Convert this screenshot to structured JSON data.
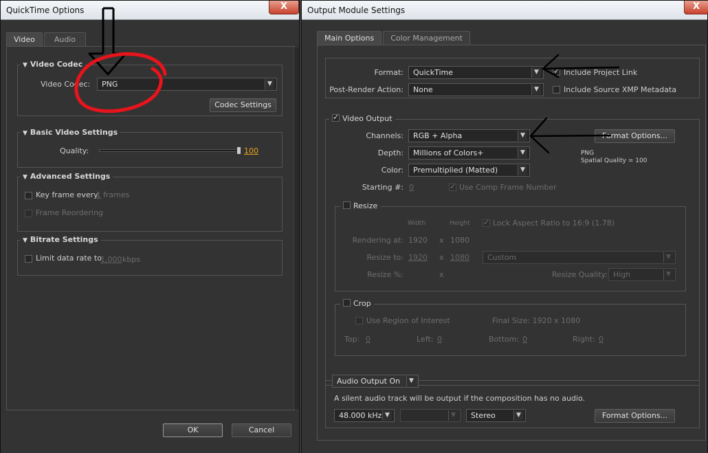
{
  "quicktime": {
    "title": "QuickTime Options",
    "close": "X",
    "tabs": [
      "Video",
      "Audio"
    ],
    "video_codec_group": "Video Codec",
    "video_codec_label": "Video Codec:",
    "video_codec_value": "PNG",
    "codec_settings_btn": "Codec Settings",
    "basic_group": "Basic Video Settings",
    "quality_label": "Quality:",
    "quality_value": "100",
    "quality_fraction": 1.0,
    "advanced_group": "Advanced Settings",
    "keyframe_label": "Key frame every",
    "keyframe_value": "1",
    "keyframe_unit": "frames",
    "frame_reordering": "Frame Reordering",
    "bitrate_group": "Bitrate Settings",
    "limit_label": "Limit data rate to",
    "limit_value": "1,000",
    "limit_unit": "kbps",
    "ok": "OK",
    "cancel": "Cancel"
  },
  "output": {
    "title": "Output Module Settings",
    "close": "X",
    "tabs": [
      "Main Options",
      "Color Management"
    ],
    "format_label": "Format:",
    "format_value": "QuickTime",
    "include_project_link": "Include Project Link",
    "post_render_label": "Post-Render Action:",
    "post_render_value": "None",
    "include_xmp": "Include Source XMP Metadata",
    "video_output": "Video Output",
    "channels_label": "Channels:",
    "channels_value": "RGB + Alpha",
    "format_options_btn": "Format Options...",
    "depth_label": "Depth:",
    "depth_value": "Millions of Colors+",
    "codec_info_line1": "PNG",
    "codec_info_line2": "Spatial Quality = 100",
    "color_label": "Color:",
    "color_value": "Premultiplied (Matted)",
    "starting_label": "Starting #:",
    "starting_value": "0",
    "use_comp_frame": "Use Comp Frame Number",
    "resize": "Resize",
    "width_hdr": "Width",
    "height_hdr": "Height",
    "lock_aspect": "Lock Aspect Ratio to 16:9 (1.78)",
    "rendering_at_label": "Rendering at:",
    "rendering_w": "1920",
    "x": "x",
    "rendering_h": "1080",
    "resize_to_label": "Resize to:",
    "resize_w": "1920",
    "resize_h": "1080",
    "resize_preset": "Custom",
    "resize_pct_label": "Resize %:",
    "resize_quality_label": "Resize Quality:",
    "resize_quality_value": "High",
    "crop": "Crop",
    "use_roi": "Use Region of Interest",
    "final_size": "Final Size: 1920 x 1080",
    "top_label": "Top:",
    "top_value": "0",
    "left_label": "Left:",
    "left_value": "0",
    "bottom_label": "Bottom:",
    "bottom_value": "0",
    "right_label": "Right:",
    "right_value": "0",
    "audio_output_value": "Audio Output On",
    "audio_note": "A silent audio track will be output if the composition has no audio.",
    "sample_rate": "48.000 kHz",
    "sample_depth": "",
    "channels_audio": "Stereo",
    "audio_format_options_btn": "Format Options..."
  },
  "colors": {
    "annotation_red": "#e8141c",
    "annotation_black": "#000000",
    "quality_value_color": "#e8a322"
  }
}
